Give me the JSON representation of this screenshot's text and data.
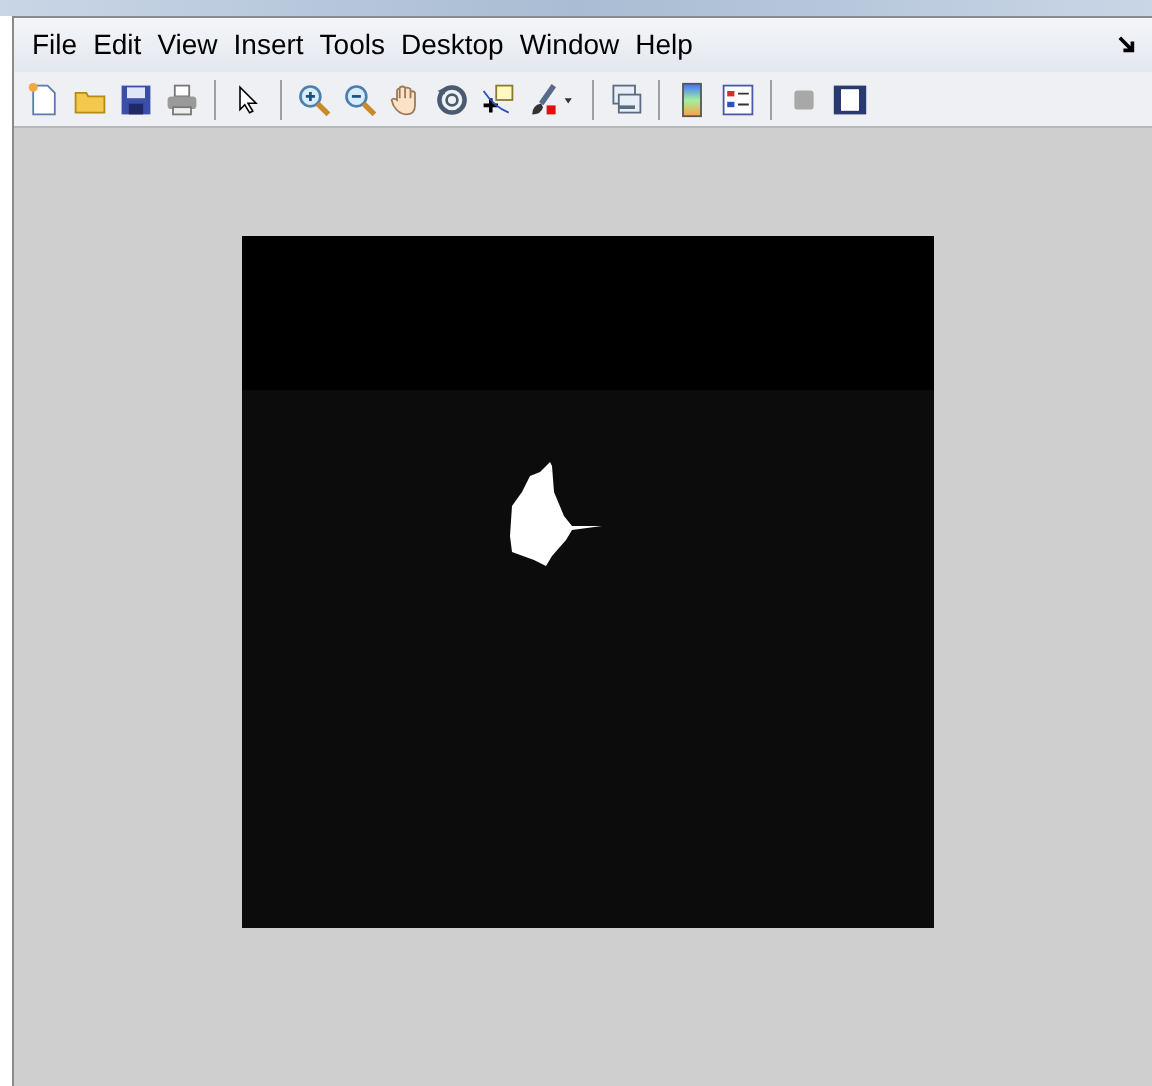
{
  "menu": [
    {
      "label": "File"
    },
    {
      "label": "Edit"
    },
    {
      "label": "View"
    },
    {
      "label": "Insert"
    },
    {
      "label": "Tools"
    },
    {
      "label": "Desktop"
    },
    {
      "label": "Window"
    },
    {
      "label": "Help"
    }
  ]
}
